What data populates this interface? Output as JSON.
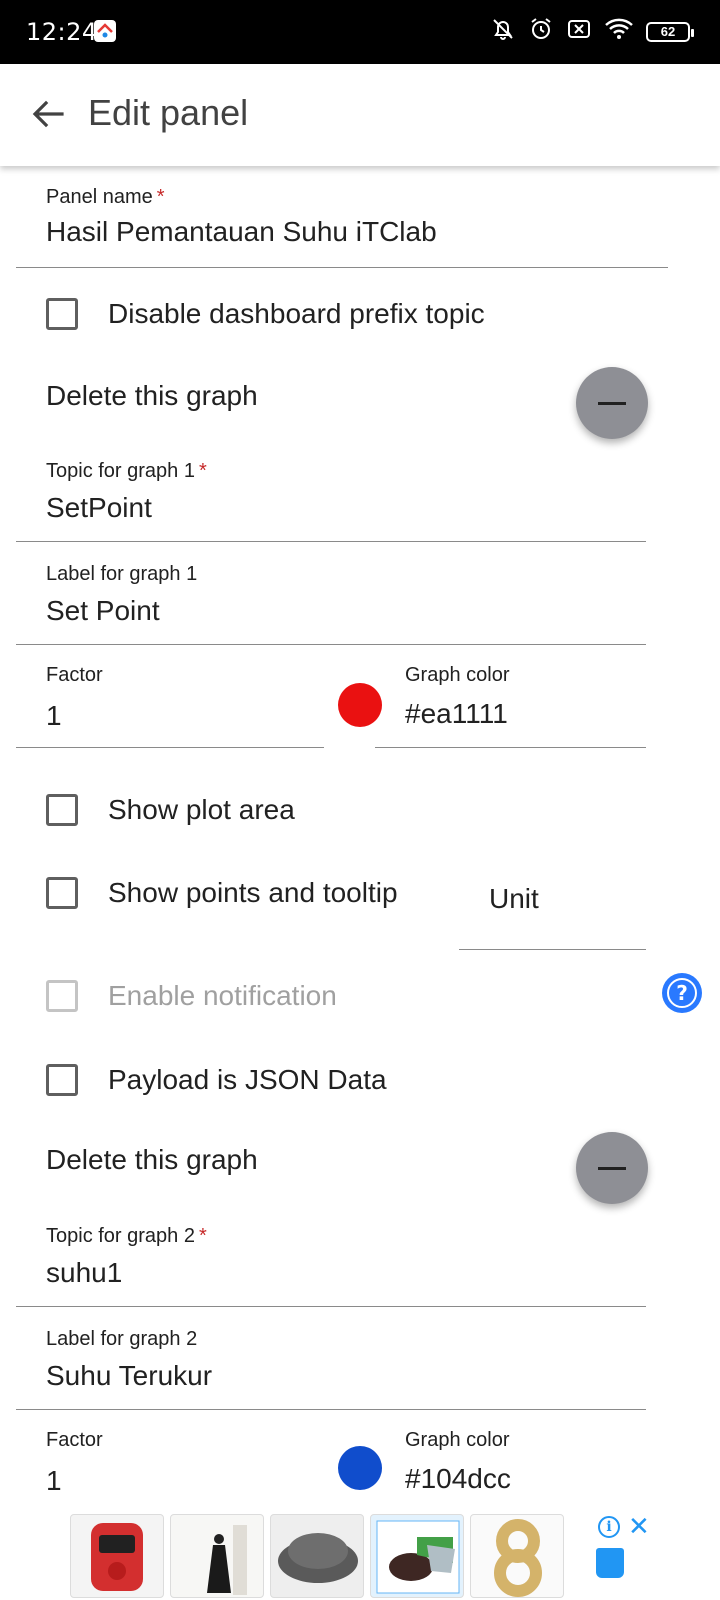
{
  "status_bar": {
    "time": "12:24",
    "battery": "62"
  },
  "app_bar": {
    "title": "Edit panel"
  },
  "form": {
    "panel_name": {
      "label": "Panel name",
      "required_mark": "*",
      "value": "Hasil Pemantauan Suhu iTClab"
    },
    "disable_prefix_label": "Disable dashboard prefix topic",
    "graphs": [
      {
        "delete_label": "Delete this graph",
        "topic": {
          "label": "Topic for graph 1",
          "required_mark": "*",
          "value": "SetPoint"
        },
        "label_field": {
          "label": "Label for graph 1",
          "value": "Set Point"
        },
        "factor": {
          "label": "Factor",
          "value": "1"
        },
        "graph_color": {
          "label": "Graph color",
          "value": "#ea1111",
          "color": "#ea1111"
        }
      },
      {
        "delete_label": "Delete this graph",
        "topic": {
          "label": "Topic for graph 2",
          "required_mark": "*",
          "value": "suhu1"
        },
        "label_field": {
          "label": "Label for graph 2",
          "value": "Suhu Terukur"
        },
        "factor": {
          "label": "Factor",
          "value": "1"
        },
        "graph_color": {
          "label": "Graph color",
          "value": "#104dcc",
          "color": "#104dcc"
        }
      }
    ],
    "show_plot_area_label": "Show plot area",
    "show_points_label": "Show points and tooltip",
    "unit_placeholder": "Unit",
    "enable_notification_label": "Enable notification",
    "payload_json_label": "Payload is JSON Data"
  },
  "ad_banner": {
    "icons": [
      "info-icon",
      "close-icon",
      "shopping-bag-icon"
    ]
  }
}
